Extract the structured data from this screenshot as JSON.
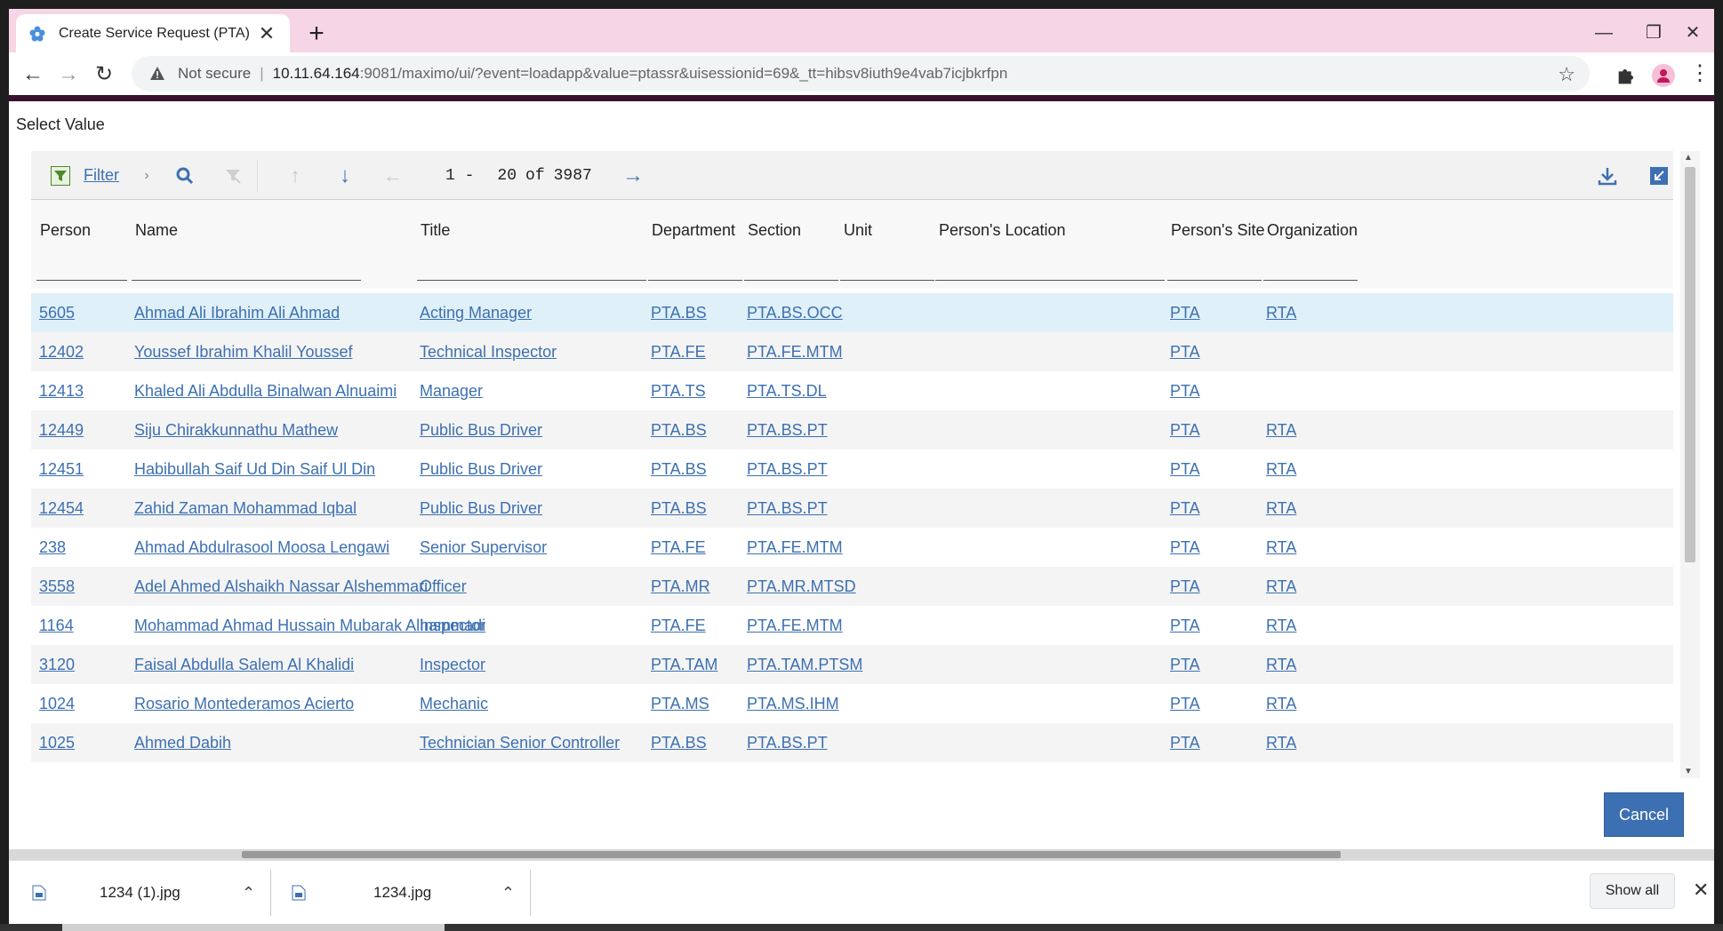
{
  "browser": {
    "tab_title": "Create Service Request (PTA)",
    "not_secure": "Not secure",
    "url_host": "10.11.64.164",
    "url_rest": ":9081/maximo/ui/?event=loadapp&value=ptassr&uisessionid=69&_tt=hibsv8iuth9e4vab7icjbkrfpn"
  },
  "dialog": {
    "title": "Select Value",
    "filter_label": "Filter",
    "pager": {
      "start": "1 -",
      "end": "20",
      "of": "of",
      "total": "3987"
    },
    "cancel_label": "Cancel"
  },
  "table": {
    "columns": [
      "Person",
      "Name",
      "Title",
      "Department",
      "Section",
      "Unit",
      "Person's Location",
      "Person's Site",
      "Organization"
    ],
    "rows": [
      [
        "5605",
        "Ahmad Ali Ibrahim Ali Ahmad",
        "Acting Manager",
        "PTA.BS",
        "PTA.BS.OCC",
        "",
        "",
        "PTA",
        "RTA"
      ],
      [
        "12402",
        "Youssef Ibrahim Khalil Youssef",
        "Technical Inspector",
        "PTA.FE",
        "PTA.FE.MTM",
        "",
        "",
        "PTA",
        ""
      ],
      [
        "12413",
        "Khaled Ali Abdulla Binalwan Alnuaimi",
        "Manager",
        "PTA.TS",
        "PTA.TS.DL",
        "",
        "",
        "PTA",
        ""
      ],
      [
        "12449",
        "Siju Chirakkunnathu Mathew",
        "Public Bus Driver",
        "PTA.BS",
        "PTA.BS.PT",
        "",
        "",
        "PTA",
        "RTA"
      ],
      [
        "12451",
        "Habibullah Saif Ud Din Saif Ul Din",
        "Public Bus Driver",
        "PTA.BS",
        "PTA.BS.PT",
        "",
        "",
        "PTA",
        "RTA"
      ],
      [
        "12454",
        "Zahid Zaman Mohammad Iqbal",
        "Public Bus Driver",
        "PTA.BS",
        "PTA.BS.PT",
        "",
        "",
        "PTA",
        "RTA"
      ],
      [
        "238",
        "Ahmad Abdulrasool Moosa Lengawi",
        "Senior Supervisor",
        "PTA.FE",
        "PTA.FE.MTM",
        "",
        "",
        "PTA",
        "RTA"
      ],
      [
        "3558",
        "Adel Ahmed Alshaikh Nassar Alshemmari",
        "Officer",
        "PTA.MR",
        "PTA.MR.MTSD",
        "",
        "",
        "PTA",
        "RTA"
      ],
      [
        "1164",
        "Mohammad Ahmad Hussain Mubarak Alhammadi",
        "Inspector",
        "PTA.FE",
        "PTA.FE.MTM",
        "",
        "",
        "PTA",
        "RTA"
      ],
      [
        "3120",
        "Faisal Abdulla Salem Al Khalidi",
        "Inspector",
        "PTA.TAM",
        "PTA.TAM.PTSM",
        "",
        "",
        "PTA",
        "RTA"
      ],
      [
        "1024",
        "Rosario Montederamos Acierto",
        "Mechanic",
        "PTA.MS",
        "PTA.MS.IHM",
        "",
        "",
        "PTA",
        "RTA"
      ],
      [
        "1025",
        "Ahmed Dabih",
        "Technician Senior Controller",
        "PTA.BS",
        "PTA.BS.PT",
        "",
        "",
        "PTA",
        "RTA"
      ]
    ]
  },
  "downloads": [
    {
      "name": "1234 (1).jpg"
    },
    {
      "name": "1234.jpg"
    }
  ],
  "downloads_show_all": "Show all",
  "colors": {
    "link": "#3d70b2",
    "selected_row": "#dff0f8",
    "alt_row": "#f4f4f4",
    "button": "#3d70b2"
  }
}
